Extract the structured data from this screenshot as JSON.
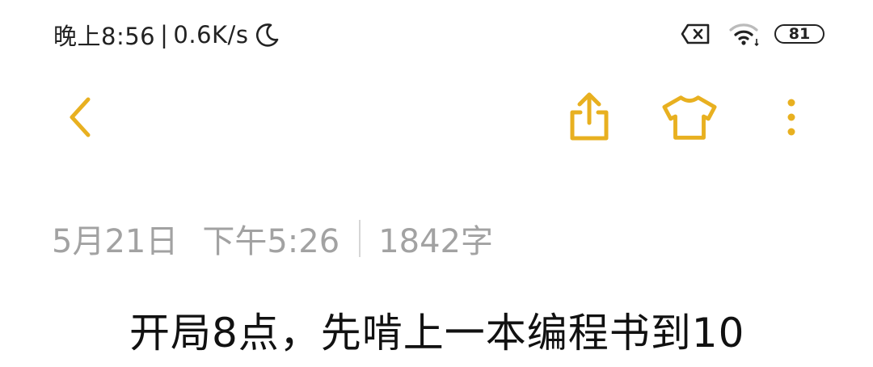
{
  "status_bar": {
    "time": "晚上8:56",
    "separator": "|",
    "net_speed": "0.6K/s",
    "moon_icon": "moon-icon",
    "sim_icon": "sim-off-icon",
    "wifi_icon": "wifi-icon",
    "battery_level": "81"
  },
  "toolbar": {
    "back_icon": "back-chevron-icon",
    "share_icon": "share-icon",
    "theme_icon": "tshirt-icon",
    "more_icon": "more-vertical-icon",
    "accent_color": "#e8b020"
  },
  "note": {
    "date": "5月21日",
    "time": "下午5:26",
    "word_count": "1842字",
    "title": "开局8点，先啃上一本编程书到10"
  }
}
